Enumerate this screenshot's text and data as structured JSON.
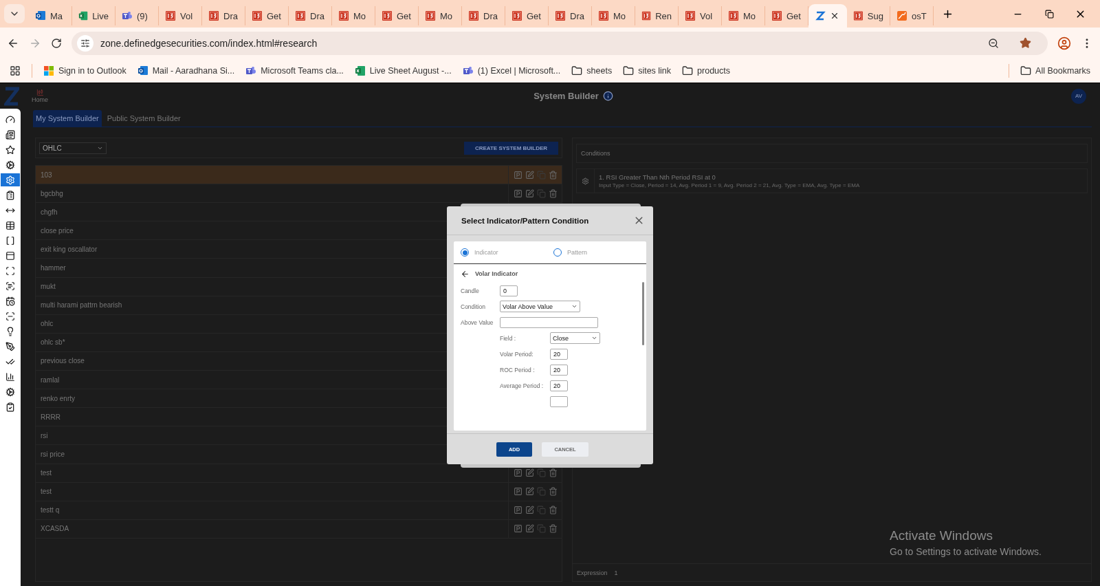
{
  "browser": {
    "tabs": [
      {
        "title": "Ma",
        "kind": "outlook",
        "selected": false
      },
      {
        "title": "Live",
        "kind": "excel",
        "selected": false
      },
      {
        "title": "(9)",
        "kind": "teams",
        "selected": false
      },
      {
        "title": "Vol",
        "kind": "i3",
        "selected": false
      },
      {
        "title": "Dra",
        "kind": "i3",
        "selected": false
      },
      {
        "title": "Get",
        "kind": "i3",
        "selected": false
      },
      {
        "title": "Dra",
        "kind": "i3",
        "selected": false
      },
      {
        "title": "Mo",
        "kind": "i3",
        "selected": false
      },
      {
        "title": "Get",
        "kind": "i3",
        "selected": false
      },
      {
        "title": "Mo",
        "kind": "i3",
        "selected": false
      },
      {
        "title": "Dra",
        "kind": "i3",
        "selected": false
      },
      {
        "title": "Get",
        "kind": "i3",
        "selected": false
      },
      {
        "title": "Dra",
        "kind": "i3",
        "selected": false
      },
      {
        "title": "Mo",
        "kind": "i3",
        "selected": false
      },
      {
        "title": "Ren",
        "kind": "i3",
        "selected": false
      },
      {
        "title": "Vol",
        "kind": "i3",
        "selected": false
      },
      {
        "title": "Mo",
        "kind": "i3",
        "selected": false
      },
      {
        "title": "Get",
        "kind": "i3",
        "selected": false
      },
      {
        "kind": "z",
        "selected": true
      },
      {
        "title": "Sug",
        "kind": "i3",
        "selected": false
      },
      {
        "title": "osT",
        "kind": "chart",
        "selected": false
      }
    ],
    "url": "zone.definedgesecurities.com/index.html#research",
    "bookmarks": [
      {
        "label": "Sign in to Outlook",
        "kind": "windows"
      },
      {
        "label": "Mail - Aaradhana Si...",
        "kind": "outlook"
      },
      {
        "label": "Microsoft Teams cla...",
        "kind": "teams"
      },
      {
        "label": "Live Sheet August -...",
        "kind": "excel"
      },
      {
        "label": "(1) Excel | Microsoft...",
        "kind": "teams"
      },
      {
        "label": "sheets",
        "kind": "folder"
      },
      {
        "label": "sites link",
        "kind": "folder"
      },
      {
        "label": "products",
        "kind": "folder"
      }
    ],
    "all_bookmarks": "All Bookmarks"
  },
  "header": {
    "home": "Home",
    "title": "System Builder",
    "avatar": "AV"
  },
  "sidebar": {
    "items": [
      {
        "selected": false
      },
      {
        "selected": false
      },
      {
        "selected": false
      },
      {
        "selected": false
      },
      {
        "selected": true
      },
      {
        "selected": false
      },
      {
        "selected": false
      },
      {
        "selected": false
      },
      {
        "selected": false
      },
      {
        "selected": false
      },
      {
        "selected": false
      },
      {
        "selected": false
      },
      {
        "selected": false
      },
      {
        "selected": false
      },
      {
        "selected": false
      },
      {
        "selected": false
      },
      {
        "selected": false
      },
      {
        "selected": false
      },
      {
        "selected": false
      },
      {
        "selected": false
      }
    ]
  },
  "tabs": [
    {
      "label": "My System Builder",
      "selected": true
    },
    {
      "label": "Public System Builder",
      "selected": false
    }
  ],
  "filter": {
    "value": "OHLC"
  },
  "create_button": "CREATE SYSTEM BUILDER",
  "systems": [
    {
      "name": "103",
      "selected": true,
      "actions": true
    },
    {
      "name": "bgcbhg",
      "selected": false,
      "actions": true
    },
    {
      "name": "chgfh",
      "selected": false
    },
    {
      "name": "close price",
      "selected": false
    },
    {
      "name": "exit king oscallator",
      "selected": false
    },
    {
      "name": "hammer",
      "selected": false
    },
    {
      "name": "mukt",
      "selected": false
    },
    {
      "name": "multi harami pattrn bearish",
      "selected": false
    },
    {
      "name": "ohlc",
      "selected": false
    },
    {
      "name": "ohlc sb*",
      "selected": false
    },
    {
      "name": "previous close",
      "selected": false
    },
    {
      "name": "ramlal",
      "selected": false
    },
    {
      "name": "renko enrty",
      "selected": false
    },
    {
      "name": "RRRR",
      "selected": false
    },
    {
      "name": "rsi",
      "selected": false
    },
    {
      "name": "rsi price",
      "selected": false
    },
    {
      "name": "test",
      "selected": false,
      "actions": true
    },
    {
      "name": "test",
      "selected": false,
      "actions": true
    },
    {
      "name": "testt q",
      "selected": false,
      "actions": true
    },
    {
      "name": "XCASDA",
      "selected": false,
      "actions": true
    }
  ],
  "conditions": {
    "heading": "Conditions",
    "items": [
      {
        "title": "1. RSI Greater Than Nth Period RSI at 0",
        "detail": "Input Type = Close, Period = 14, Avg. Period 1 = 9, Avg. Period 2 = 21, Avg. Type = EMA, Avg. Type = EMA"
      }
    ],
    "expression": {
      "label": "Expression",
      "value": "1"
    }
  },
  "modal": {
    "title": "Select Indicator/Pattern Condition",
    "options": [
      {
        "label": "Indicator",
        "selected": true
      },
      {
        "label": "Pattern",
        "selected": false
      }
    ],
    "section": "Volar Indicator",
    "fields": [
      {
        "label": "Candle",
        "kind": "input",
        "value": "0"
      },
      {
        "label": "Condition",
        "kind": "select",
        "value": "Volar Above Value"
      },
      {
        "label": "Above Value",
        "kind": "input"
      }
    ],
    "params": [
      {
        "label": "Field :",
        "kind": "select",
        "value": "Close"
      },
      {
        "label": "Volar Period:",
        "kind": "input",
        "value": "20"
      },
      {
        "label": "ROC Period :",
        "kind": "input",
        "value": "20"
      },
      {
        "label": "Average Period :",
        "kind": "input",
        "value": "20"
      },
      {
        "kind": "input"
      }
    ],
    "add": "ADD",
    "cancel": "CANCEL"
  },
  "watermark": {
    "title": "Activate Windows",
    "subtitle": "Go to Settings to activate Windows."
  }
}
